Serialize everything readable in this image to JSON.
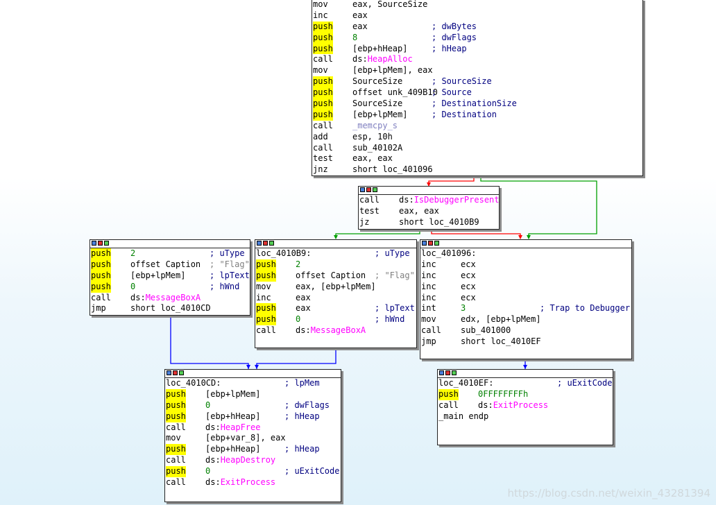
{
  "colors": {
    "highlight": "#ffff00",
    "api": "#ff00ff",
    "number": "#008000",
    "comment": "#000080",
    "edge_false": "#ff0000",
    "edge_true": "#008000",
    "edge_jump": "#0000ff"
  },
  "header_icons": [
    "graph-icon",
    "edit-icon",
    "comment-icon"
  ],
  "watermark": "https://blog.csdn.net/weixin_43281394",
  "nodes": {
    "block1": [
      {
        "m": "mov",
        "o": "eax, SourceSize",
        "c": ""
      },
      {
        "m": "inc",
        "o": "eax",
        "c": ""
      },
      {
        "m": "push",
        "o": "eax",
        "c": "; dwBytes"
      },
      {
        "m": "push",
        "o": "8",
        "c": "; dwFlags"
      },
      {
        "m": "push",
        "o": "[ebp+hHeap]",
        "c": "; hHeap"
      },
      {
        "m": "call",
        "o": "ds:HeapAlloc",
        "c": ""
      },
      {
        "m": "mov",
        "o": "[ebp+lpMem], eax",
        "c": ""
      },
      {
        "m": "push",
        "o": "SourceSize",
        "c": "; SourceSize"
      },
      {
        "m": "push",
        "o": "offset unk_409B10",
        "c": "; Source"
      },
      {
        "m": "push",
        "o": "SourceSize",
        "c": "; DestinationSize"
      },
      {
        "m": "push",
        "o": "[ebp+lpMem]",
        "c": "; Destination"
      },
      {
        "m": "call",
        "o": "_memcpy_s",
        "c": ""
      },
      {
        "m": "add",
        "o": "esp, 10h",
        "c": ""
      },
      {
        "m": "call",
        "o": "sub_40102A",
        "c": ""
      },
      {
        "m": "test",
        "o": "eax, eax",
        "c": ""
      },
      {
        "m": "jnz",
        "o": "short loc_401096",
        "c": ""
      }
    ],
    "block2": [
      {
        "m": "call",
        "o": "ds:IsDebuggerPresent",
        "c": ""
      },
      {
        "m": "test",
        "o": "eax, eax",
        "c": ""
      },
      {
        "m": "jz",
        "o": "short loc_4010B9",
        "c": ""
      }
    ],
    "block3": [
      {
        "m": "push",
        "o": "2",
        "c": "; uType"
      },
      {
        "m": "push",
        "o": "offset Caption",
        "c": "; \"Flag\""
      },
      {
        "m": "push",
        "o": "[ebp+lpMem]",
        "c": "; lpText"
      },
      {
        "m": "push",
        "o": "0",
        "c": "; hWnd"
      },
      {
        "m": "call",
        "o": "ds:MessageBoxA",
        "c": ""
      },
      {
        "m": "jmp",
        "o": "short loc_4010CD",
        "c": ""
      }
    ],
    "block4": [
      {
        "label": "loc_4010B9:",
        "c": "; uType"
      },
      {
        "m": "push",
        "o": "2",
        "c": ""
      },
      {
        "m": "push",
        "o": "offset Caption",
        "c": "; \"Flag\""
      },
      {
        "m": "mov",
        "o": "eax, [ebp+lpMem]",
        "c": ""
      },
      {
        "m": "inc",
        "o": "eax",
        "c": ""
      },
      {
        "m": "push",
        "o": "eax",
        "c": "; lpText"
      },
      {
        "m": "push",
        "o": "0",
        "c": "; hWnd"
      },
      {
        "m": "call",
        "o": "ds:MessageBoxA",
        "c": ""
      }
    ],
    "block5": [
      {
        "label": "loc_401096:",
        "c": ""
      },
      {
        "m": "inc",
        "o": "ecx",
        "c": ""
      },
      {
        "m": "inc",
        "o": "ecx",
        "c": ""
      },
      {
        "m": "inc",
        "o": "ecx",
        "c": ""
      },
      {
        "m": "inc",
        "o": "ecx",
        "c": ""
      },
      {
        "m": "int",
        "o": "3",
        "c": "; Trap to Debugger"
      },
      {
        "m": "mov",
        "o": "edx, [ebp+lpMem]",
        "c": ""
      },
      {
        "m": "call",
        "o": "sub_401000",
        "c": ""
      },
      {
        "m": "jmp",
        "o": "short loc_4010EF",
        "c": ""
      }
    ],
    "block6": [
      {
        "label": "loc_4010CD:",
        "c": "; lpMem"
      },
      {
        "m": "push",
        "o": "[ebp+lpMem]",
        "c": ""
      },
      {
        "m": "push",
        "o": "0",
        "c": "; dwFlags"
      },
      {
        "m": "push",
        "o": "[ebp+hHeap]",
        "c": "; hHeap"
      },
      {
        "m": "call",
        "o": "ds:HeapFree",
        "c": ""
      },
      {
        "m": "mov",
        "o": "[ebp+var_8], eax",
        "c": ""
      },
      {
        "m": "push",
        "o": "[ebp+hHeap]",
        "c": "; hHeap"
      },
      {
        "m": "call",
        "o": "ds:HeapDestroy",
        "c": ""
      },
      {
        "m": "push",
        "o": "0",
        "c": "; uExitCode"
      },
      {
        "m": "call",
        "o": "ds:ExitProcess",
        "c": ""
      }
    ],
    "block7": [
      {
        "label": "loc_4010EF:",
        "c": "; uExitCode"
      },
      {
        "m": "push",
        "o": "0FFFFFFFFh",
        "c": ""
      },
      {
        "m": "call",
        "o": "ds:ExitProcess",
        "c": ""
      },
      {
        "label": "_main endp",
        "c": ""
      }
    ]
  }
}
